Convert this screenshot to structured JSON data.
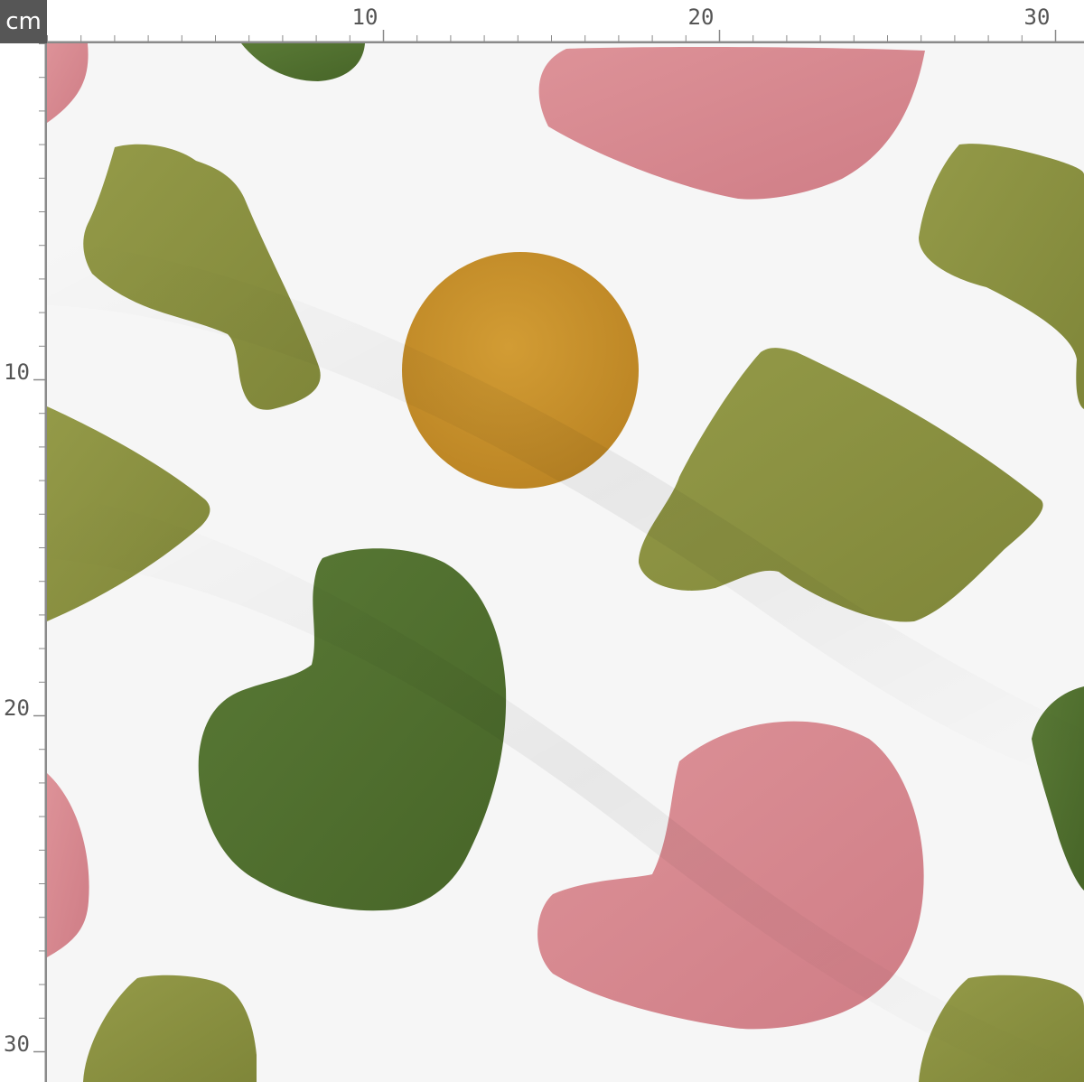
{
  "ruler": {
    "unit": "cm",
    "top_labels": [
      "10",
      "20",
      "30"
    ],
    "left_labels": [
      "10",
      "20",
      "30"
    ]
  },
  "colors": {
    "ruler_badge": "#565656",
    "ruler_line": "#8a8a8a",
    "fabric_background": "#f6f6f6",
    "pink": "#d6838b",
    "olive": "#8f9444",
    "forest": "#4f6e2e",
    "mustard": "#c8922a"
  },
  "pattern": {
    "motifs": [
      "pink blob",
      "olive blob",
      "forest green blob",
      "mustard circle"
    ]
  }
}
